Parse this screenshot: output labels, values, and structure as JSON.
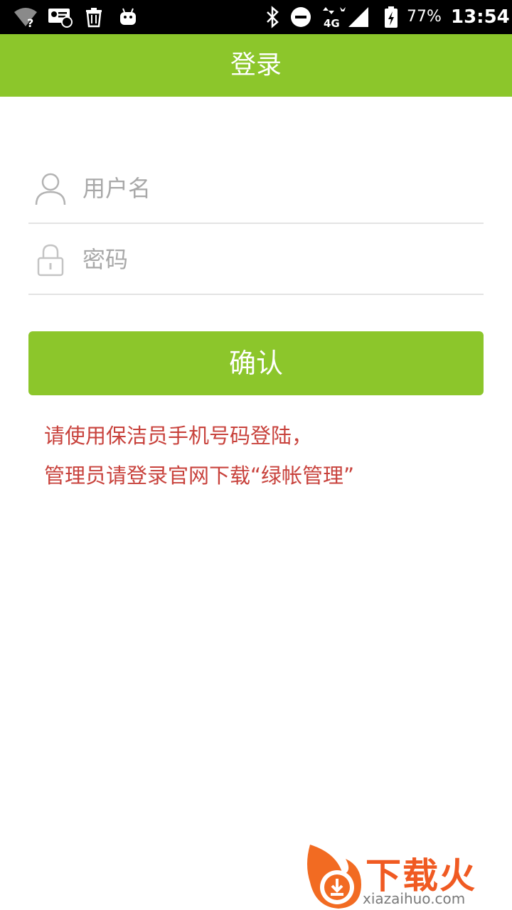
{
  "status_bar": {
    "battery_percent": "77%",
    "time": "13:54",
    "network_type": "4G",
    "icons": [
      "wifi-question-icon",
      "contact-card-icon",
      "trash-icon",
      "android-icon",
      "bluetooth-icon",
      "do-not-disturb-icon",
      "network-4g-icon",
      "signal-icon",
      "battery-charging-icon"
    ]
  },
  "app_bar": {
    "title": "登录"
  },
  "form": {
    "username": {
      "placeholder": "用户名",
      "value": ""
    },
    "password": {
      "placeholder": "密码",
      "value": ""
    },
    "confirm_label": "确认"
  },
  "notice": {
    "line1": "请使用保洁员手机号码登陆，",
    "line2": "管理员请登录官网下载“绿帐管理”"
  },
  "watermark": {
    "title": "下载火",
    "subtitle": "xiazaihuo.com"
  },
  "colors": {
    "accent": "#8cc62b",
    "notice": "#c8423c",
    "placeholder": "#a8a8a8",
    "divider": "#e3e3e3"
  }
}
